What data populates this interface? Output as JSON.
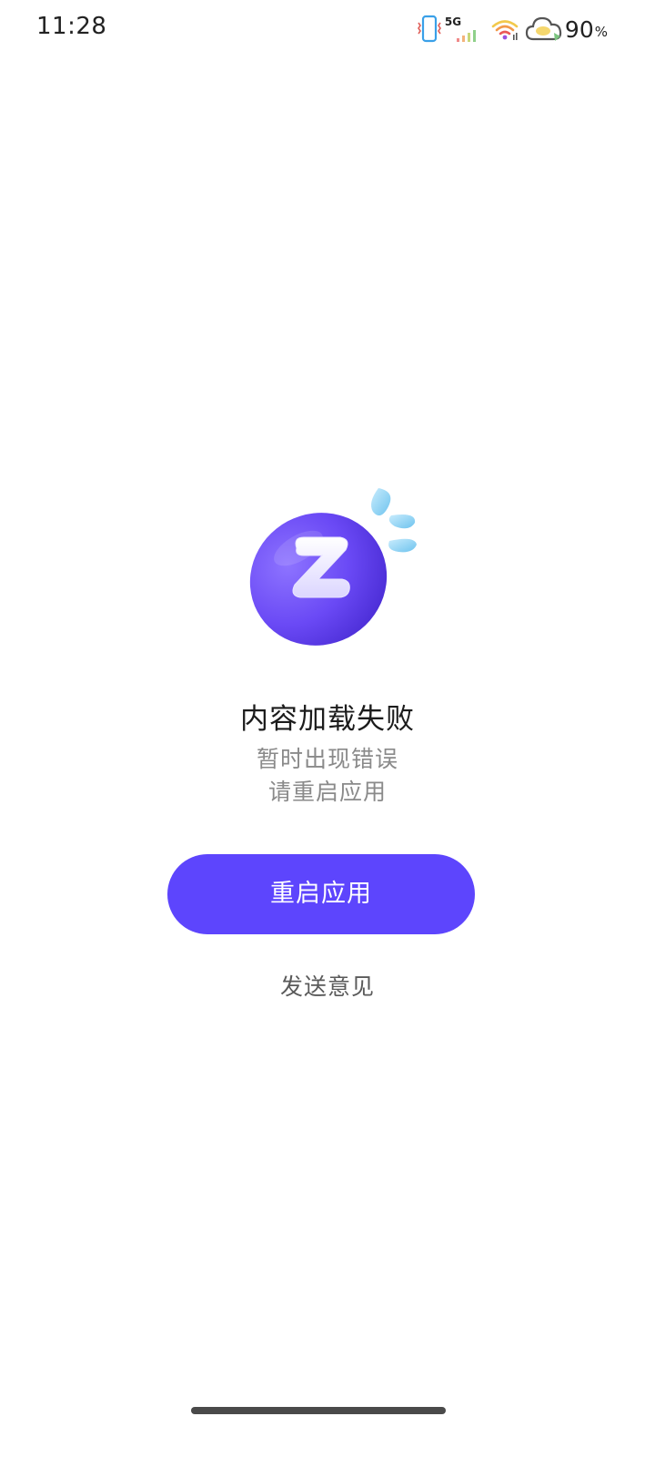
{
  "status_bar": {
    "time": "11:28",
    "network": "5G",
    "battery": "90",
    "battery_unit": "%",
    "icons": [
      "vibrate-icon",
      "signal-icon",
      "wifi-icon",
      "weather-cloud-icon"
    ]
  },
  "error": {
    "title": "内容加载失败",
    "message_line1": "暂时出现错误",
    "message_line2": "请重启应用"
  },
  "actions": {
    "restart_label": "重启应用",
    "feedback_label": "发送意见"
  },
  "colors": {
    "accent": "#5d45fd",
    "illustration_purple": "#6b4cf6",
    "drop_blue": "#8fd3f4"
  }
}
